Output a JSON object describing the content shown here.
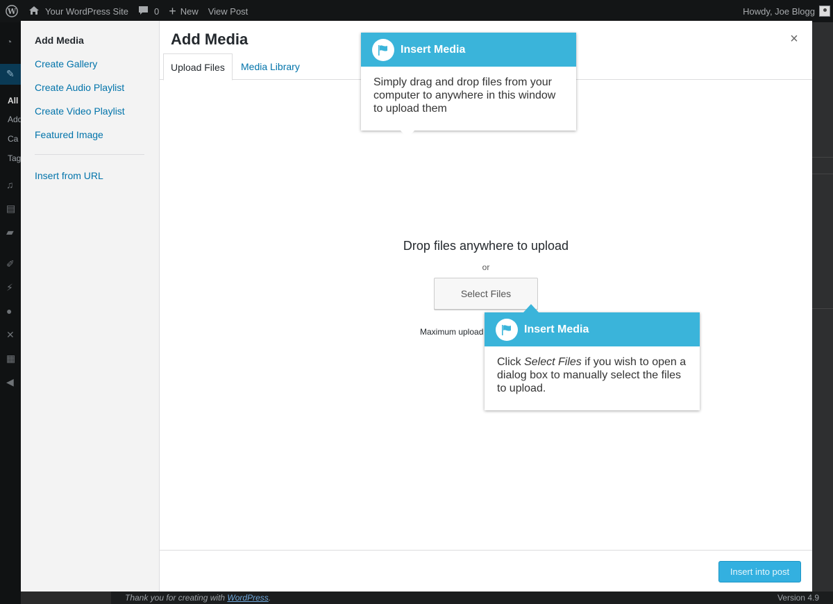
{
  "adminbar": {
    "site_name": "Your WordPress Site",
    "comments_count": "0",
    "new_label": "New",
    "view_post": "View Post",
    "howdy": "Howdy, Joe Blogg"
  },
  "sidemenu": {
    "sub_items": [
      "All",
      "Add",
      "Ca",
      "Tag"
    ]
  },
  "footer": {
    "thanks_prefix": "Thank you for creating with",
    "thanks_link": "WordPress",
    "thanks_suffix": ".",
    "version": "Version 4.9"
  },
  "modal": {
    "menu": {
      "items": [
        "Add Media",
        "Create Gallery",
        "Create Audio Playlist",
        "Create Video Playlist",
        "Featured Image"
      ],
      "insert_url": "Insert from URL"
    },
    "title": "Add Media",
    "close": "×",
    "tabs": [
      "Upload Files",
      "Media Library"
    ],
    "drop_title": "Drop files anywhere to upload",
    "or": "or",
    "select_files": "Select Files",
    "max_upload": "Maximum upload",
    "insert_button": "Insert into post"
  },
  "tooltips": {
    "tip1": {
      "title": "Insert Media",
      "body": "Simply drag and drop files from your computer to anywhere in this window to upload them"
    },
    "tip2": {
      "title": "Insert Media",
      "body_prefix": "Click ",
      "body_em": "Select Files",
      "body_suffix": " if you wish to open a dialog box to manually select the files to upload."
    }
  },
  "colors": {
    "accent": "#0073aa",
    "tooltip_header": "#3ab4da",
    "primary_button": "#33b0e0"
  }
}
